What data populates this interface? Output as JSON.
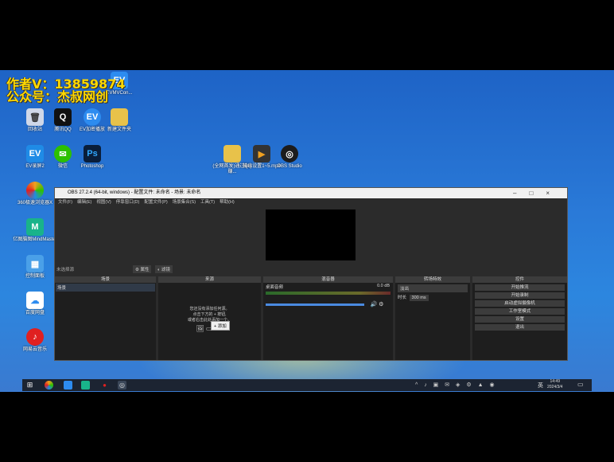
{
  "overlay": {
    "line1": "作者V：13859874",
    "line2": "公众号：杰叔网创"
  },
  "desktop_icons": [
    {
      "label": "回收站",
      "icon": "recycle-bin-icon",
      "color": "#d0d8e8"
    },
    {
      "label": "腾讯QQ",
      "icon": "qq-icon",
      "color": "#111111"
    },
    {
      "label": "EV加密播放",
      "icon": "ev-player-icon",
      "color": "#2d8cf0"
    },
    {
      "label": "新建文件夹",
      "icon": "folder-icon",
      "color": "#e8c24a"
    },
    {
      "label": "EV录屏2",
      "icon": "ev-recorder-icon",
      "color": "#1f8be6"
    },
    {
      "label": "微信",
      "icon": "wechat-icon",
      "color": "#2dc100"
    },
    {
      "label": "Photoshop",
      "icon": "photoshop-icon",
      "color": "#0a1e3a"
    },
    {
      "label": "360极速浏览器X",
      "icon": "browser-360-icon",
      "color": "#f0a020"
    },
    {
      "label": "亿图脑图MindMaster",
      "icon": "mindmaster-icon",
      "color": "#19b38a"
    },
    {
      "label": "控制面板",
      "icon": "control-panel-icon",
      "color": "#4aa0e8"
    },
    {
      "label": "百度网盘",
      "icon": "baidu-netdisk-icon",
      "color": "#ffffff"
    },
    {
      "label": "网易云音乐",
      "icon": "netease-music-icon",
      "color": "#e02020"
    },
    {
      "label": "EVMVCon...",
      "icon": "ev-mv-icon",
      "color": "#2d8cf0"
    },
    {
      "label": "(全网首发)通过QQ赚...",
      "icon": "folder-icon",
      "color": "#e8c24a"
    },
    {
      "label": "输出设置1~5.mp4",
      "icon": "video-file-icon",
      "color": "#333333"
    },
    {
      "label": "OBS Studio",
      "icon": "obs-icon",
      "color": "#1c1c1c"
    }
  ],
  "obs": {
    "title": "OBS 27.2.4 (64-bit, windows) - 配置文件: 未命名 - 场景: 未命名",
    "menu": [
      "文件(F)",
      "编辑(E)",
      "视图(V)",
      "停靠窗口(D)",
      "配置文件(P)",
      "场景集合(S)",
      "工具(T)",
      "帮助(H)"
    ],
    "scene_bar": {
      "no_source": "未选择源",
      "props": "属性",
      "filters": "滤镜"
    },
    "panels": {
      "scenes": {
        "title": "场景",
        "item": "场景"
      },
      "sources": {
        "title": "来源",
        "hint1": "您还没有添加任何源。",
        "hint2": "点击下方的 + 按钮,",
        "hint3": "或者右击此处添加一个。",
        "tooltip": "添加"
      },
      "mixer": {
        "title": "混音器",
        "track": "桌面音频",
        "level": "0.0 dB"
      },
      "transitions": {
        "title": "转场特效",
        "type": "淡出",
        "duration_label": "时长",
        "duration_value": "300 ms"
      },
      "controls": {
        "title": "控件",
        "buttons": [
          "开始推流",
          "开始录制",
          "启动虚拟摄像机",
          "工作室模式",
          "设置",
          "退出"
        ]
      }
    }
  },
  "taskbar": {
    "time": "14:49",
    "date": "2024/3/4",
    "ime": "英"
  }
}
